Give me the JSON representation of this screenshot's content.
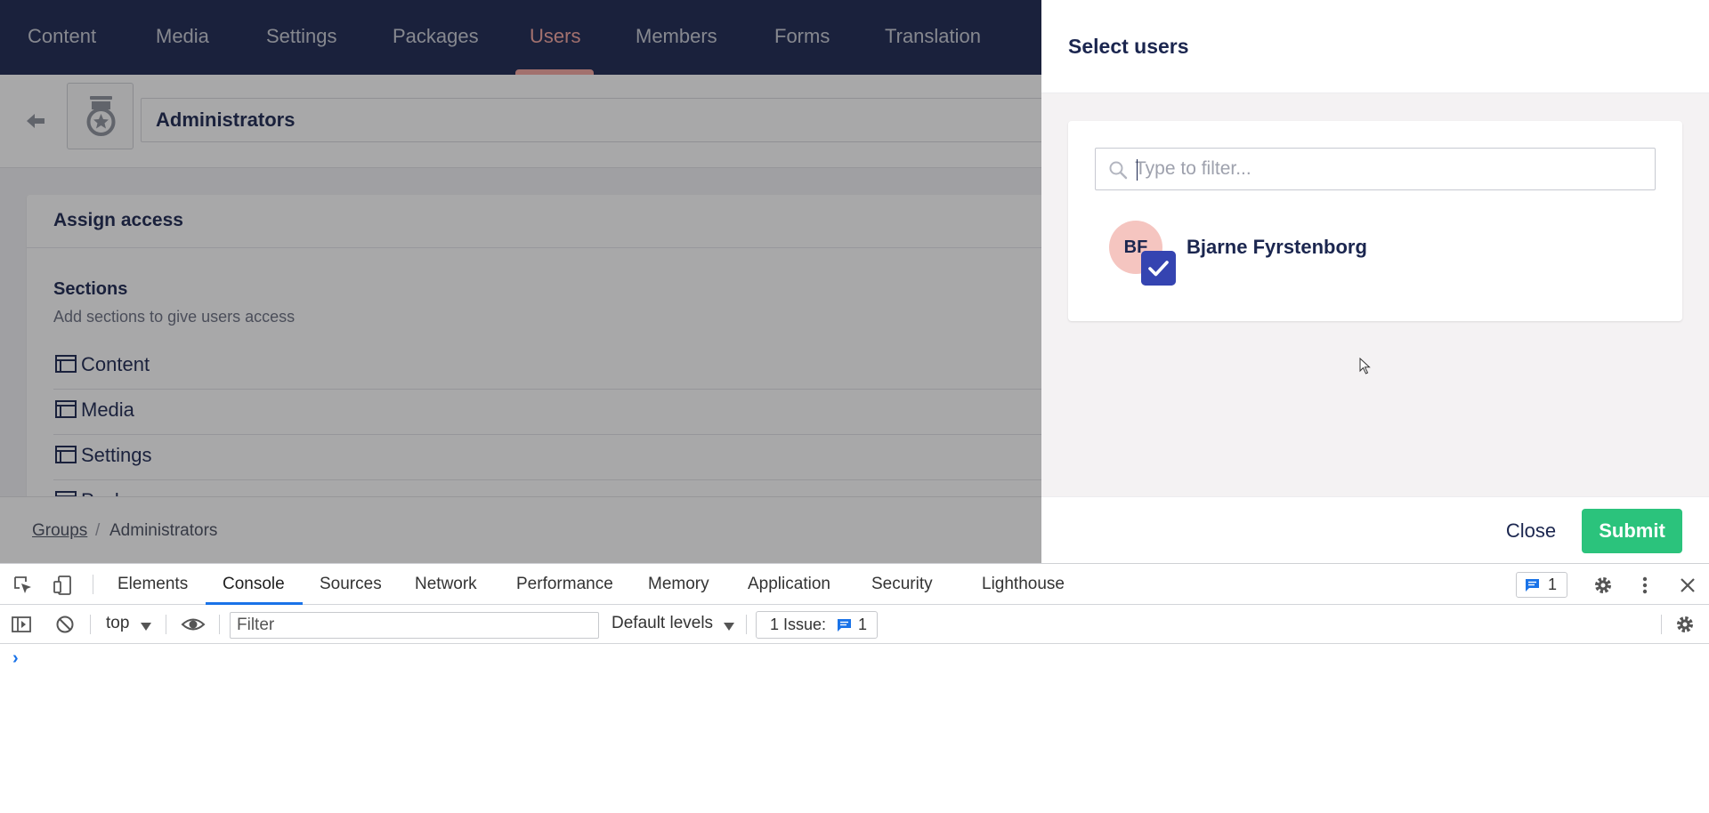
{
  "nav": {
    "tabs": [
      {
        "label": "Content"
      },
      {
        "label": "Media"
      },
      {
        "label": "Settings"
      },
      {
        "label": "Packages"
      },
      {
        "label": "Users"
      },
      {
        "label": "Members"
      },
      {
        "label": "Forms"
      },
      {
        "label": "Translation"
      }
    ],
    "active_tab": "Users"
  },
  "header": {
    "group_name": "Administrators",
    "icon": "medal-icon"
  },
  "assign_access": {
    "title": "Assign access",
    "sections_title": "Sections",
    "sections_description": "Add sections to give users access",
    "sections": [
      {
        "label": "Content"
      },
      {
        "label": "Media"
      },
      {
        "label": "Settings"
      },
      {
        "label": "Packages"
      }
    ]
  },
  "breadcrumb": {
    "link": "Groups",
    "separator": "/",
    "current": "Administrators"
  },
  "dialog": {
    "title": "Select users",
    "filter_placeholder": "Type to filter...",
    "users": [
      {
        "initials": "BF",
        "name": "Bjarne Fyrstenborg",
        "selected": true
      }
    ],
    "close_label": "Close",
    "submit_label": "Submit"
  },
  "devtools": {
    "tabs": [
      {
        "label": "Elements"
      },
      {
        "label": "Console"
      },
      {
        "label": "Sources"
      },
      {
        "label": "Network"
      },
      {
        "label": "Performance"
      },
      {
        "label": "Memory"
      },
      {
        "label": "Application"
      },
      {
        "label": "Security"
      },
      {
        "label": "Lighthouse"
      }
    ],
    "active_tab": "Console",
    "issue_count": "1",
    "context": "top",
    "filter_placeholder": "Filter",
    "levels": "Default levels",
    "issues_label": "1 Issue:",
    "issues_count": "1",
    "prompt": "›"
  },
  "colors": {
    "nav_bg": "#1b264f",
    "accent_pink": "#f5a6a0",
    "submit_green": "#2bc37c",
    "check_blue": "#3544b1",
    "devtools_blue": "#1a73e8"
  }
}
